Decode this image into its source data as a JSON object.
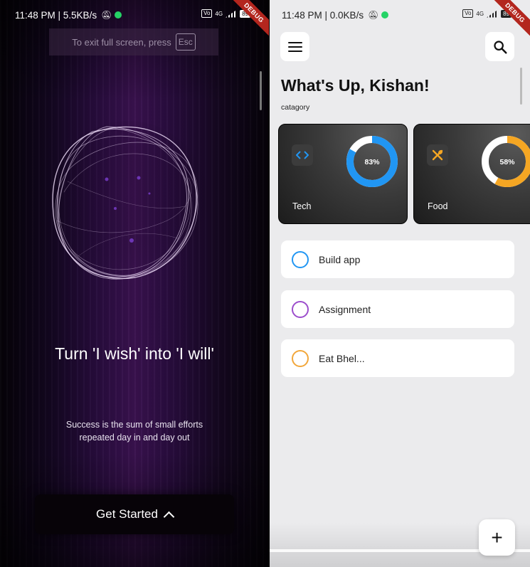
{
  "left_phone": {
    "status": {
      "time_speed": "11:48 PM | 5.5KB/s",
      "battery": "89",
      "network": "4G",
      "debug": "DEBUG"
    },
    "esc_hint": {
      "text": "To exit full screen, press",
      "key": "Esc"
    },
    "headline": "Turn 'I wish' into 'I will'",
    "subline_1": "Success is the sum of small efforts",
    "subline_2": "repeated day in and day out",
    "cta_label": "Get Started",
    "orb_color": "#e8d6f2",
    "bg_accent": "#3a124f"
  },
  "right_phone": {
    "status": {
      "time_speed": "11:48 PM | 0.0KB/s",
      "battery": "89",
      "network": "4G",
      "debug": "DEBUG"
    },
    "menu_icon": "hamburger-icon",
    "search_icon": "search-icon",
    "greeting": "What's Up, Kishan!",
    "category_label": "catagory",
    "categories": [
      {
        "name": "Tech",
        "percent_label": "83%",
        "percent": 83,
        "color": "#2196f3",
        "icon": "code-icon"
      },
      {
        "name": "Food",
        "percent_label": "58%",
        "percent": 58,
        "color": "#f5a623",
        "icon": "fork-knife-icon"
      }
    ],
    "tasks": [
      {
        "name": "Build app",
        "color": "#2196f3"
      },
      {
        "name": "Assignment",
        "color": "#9c4dcc"
      },
      {
        "name": "Eat Bhel...",
        "color": "#f2a73b"
      }
    ],
    "fab_label": "+"
  }
}
